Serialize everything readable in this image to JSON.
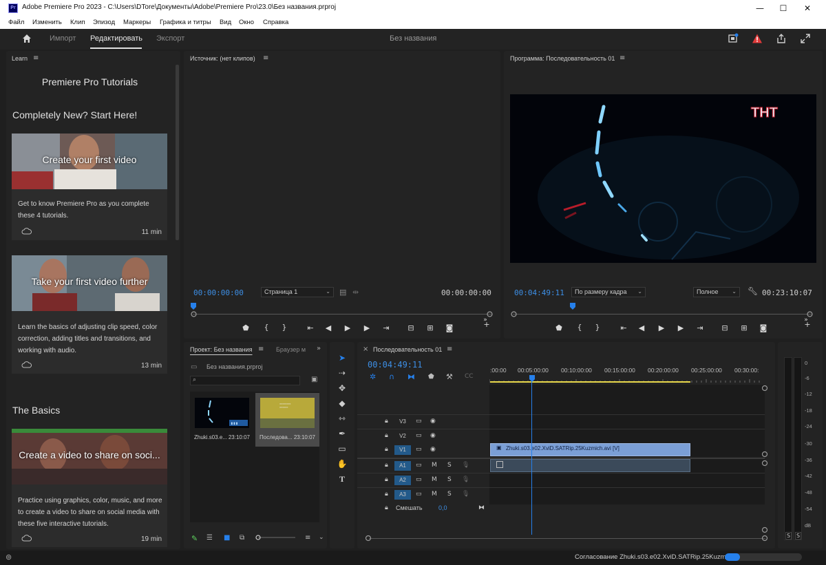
{
  "window": {
    "logo": "Pr",
    "title": "Adobe Premiere Pro 2023 - C:\\Users\\DTore\\Документы\\Adobe\\Premiere Pro\\23.0\\Без названия.prproj",
    "minimize": "—",
    "maximize": "☐",
    "close": "✕"
  },
  "menu": [
    "Файл",
    "Изменить",
    "Клип",
    "Эпизод",
    "Маркеры",
    "Графика и титры",
    "Вид",
    "Окно",
    "Справка"
  ],
  "workspace": {
    "tabs": [
      "Импорт",
      "Редактировать",
      "Экспорт"
    ],
    "active_tab": "Редактировать",
    "project_name": "Без названия"
  },
  "learn": {
    "panel_title": "Learn",
    "heading": "Premiere Pro Tutorials",
    "section1": "Completely New? Start Here!",
    "section2": "The Basics",
    "cards": [
      {
        "title": "Create your first video",
        "desc": "Get to know Premiere Pro as you complete these 4 tutorials.",
        "duration": "11 min"
      },
      {
        "title": "Take your first video further",
        "desc": "Learn the basics of adjusting clip speed, color correction, adding titles and transitions, and working with audio.",
        "duration": "13 min"
      },
      {
        "title": "Create a video to share on soci...",
        "desc": "Practice using graphics, color, music, and more to create a video to share on social media with these five interactive tutorials.",
        "duration": "19 min"
      }
    ]
  },
  "source": {
    "panel_title": "Источник: (нет клипов)",
    "timecode_left": "00:00:00:00",
    "timecode_right": "00:00:00:00",
    "page_select": "Страница 1"
  },
  "program": {
    "panel_title": "Программа: Последовательность 01",
    "timecode_left": "00:04:49:11",
    "timecode_right": "00:23:10:07",
    "fit_select": "По размеру кадра",
    "quality_select": "Полное",
    "watermark": "ТНТ"
  },
  "project": {
    "tab1": "Проект: Без названия",
    "tab2": "Браузер м",
    "file": "Без названия.prproj",
    "items": [
      {
        "name": "Zhuki.s03.e...",
        "duration": "23:10:07"
      },
      {
        "name": "Последова...",
        "duration": "23:10:07"
      }
    ]
  },
  "timeline": {
    "tab": "Последовательность 01",
    "timecode": "00:04:49:11",
    "ruler": [
      ":00:00",
      "00:05:00:00",
      "00:10:00:00",
      "00:15:00:00",
      "00:20:00:00",
      "00:25:00:00",
      "00:30:00:"
    ],
    "video_tracks": [
      "V3",
      "V2",
      "V1"
    ],
    "audio_tracks": [
      "A1",
      "A2",
      "A3"
    ],
    "mix_label": "Смешать",
    "mix_value": "0,0",
    "clip_name": "Zhuki.s03.e02.XviD.SATRip.25Kuzmich.avi [V]",
    "m": "M",
    "s": "S"
  },
  "meters": {
    "scale": [
      "0",
      "-6",
      "-12",
      "-18",
      "-24",
      "-30",
      "-36",
      "-42",
      "-48",
      "-54",
      "dB"
    ],
    "solo": [
      "S",
      "S"
    ]
  },
  "status": {
    "text": "Согласование Zhuki.s03.e02.XviD.SATRip.25Kuzmi...",
    "progress": 0.2
  },
  "colors": {
    "accent_blue": "#2680eb",
    "timecode_blue": "#3d8fe6",
    "warning_red": "#e03a3a",
    "clip_video": "#7b9fd6"
  }
}
